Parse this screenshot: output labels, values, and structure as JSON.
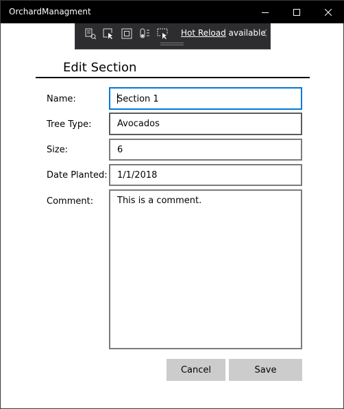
{
  "window": {
    "title": "OrchardManagment"
  },
  "devtools": {
    "icons": [
      "live-visual-tree-icon",
      "select-element-icon",
      "display-layout-adorners-icon",
      "track-focus-icon",
      "preview-selection-icon"
    ],
    "hot_reload_link": "Hot Reload",
    "hot_reload_status": " available"
  },
  "form": {
    "heading": "Edit Section",
    "fields": {
      "name": {
        "label": "Name:",
        "value": "Section 1"
      },
      "tree_type": {
        "label": "Tree Type:",
        "value": "Avocados"
      },
      "size": {
        "label": "Size:",
        "value": "6"
      },
      "date_planted": {
        "label": "Date Planted:",
        "value": "1/1/2018"
      },
      "comment": {
        "label": "Comment:",
        "value": "This is a comment."
      }
    },
    "buttons": {
      "cancel": "Cancel",
      "save": "Save"
    }
  },
  "colors": {
    "titlebar": "#000000",
    "devbar": "#2d2d30",
    "focus_border": "#0078d7",
    "field_border": "#7a7a7a",
    "button_bg": "#cccccc"
  }
}
